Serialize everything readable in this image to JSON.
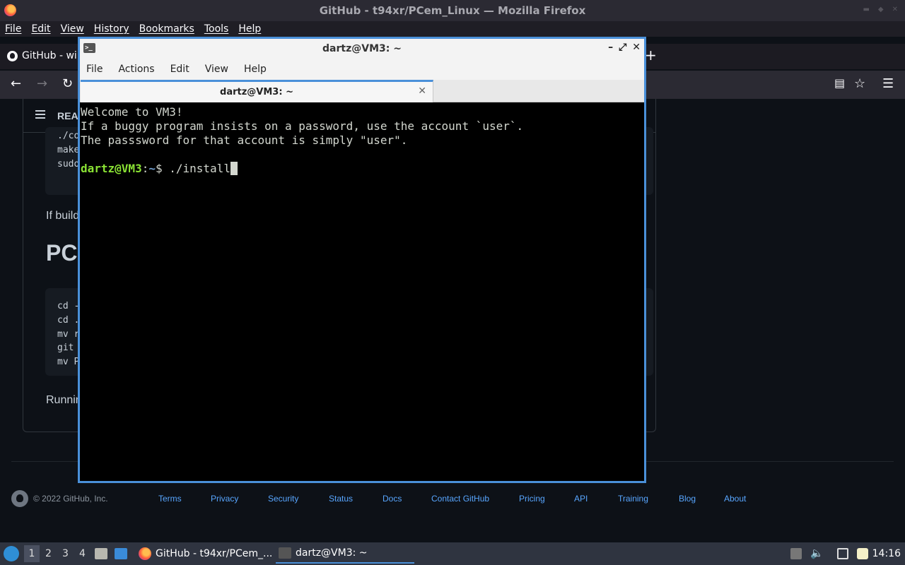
{
  "firefox": {
    "window_title": "GitHub - t94xr/PCem_Linux — Mozilla Firefox",
    "menu": [
      "File",
      "Edit",
      "View",
      "History",
      "Bookmarks",
      "Tools",
      "Help"
    ],
    "tab_label": "GitHub - wir",
    "newtab": "+"
  },
  "github": {
    "readme_title": "REA",
    "code_block_1": [
      "./co",
      "make",
      "sudo"
    ],
    "text_1": "If build",
    "heading": "PC",
    "code_block_2": [
      "cd -",
      "cd .",
      "mv r",
      "git",
      "mv P"
    ],
    "text_2": "Runnin",
    "footer": {
      "copyright": "© 2022 GitHub, Inc.",
      "links": [
        "Terms",
        "Privacy",
        "Security",
        "Status",
        "Docs",
        "Contact GitHub",
        "Pricing",
        "API",
        "Training",
        "Blog",
        "About"
      ]
    }
  },
  "terminal": {
    "title": "dartz@VM3: ~",
    "menu": [
      "File",
      "Actions",
      "Edit",
      "View",
      "Help"
    ],
    "tab_label": "dartz@VM3: ~",
    "lines": [
      "Welcome to VM3!",
      "If a buggy program insists on a password, use the account `user`.",
      "The passsword for that account is simply \"user\"."
    ],
    "prompt_user": "dartz@VM3",
    "prompt_sep": ":",
    "prompt_path": "~",
    "prompt_symbol": "$ ",
    "command": "./install"
  },
  "taskbar": {
    "workspaces": [
      "1",
      "2",
      "3",
      "4"
    ],
    "tasks": [
      "GitHub - t94xr/PCem_...",
      "dartz@VM3: ~"
    ],
    "clock": "14:16"
  },
  "colors": {
    "accent": "#4a90d9",
    "prompt_user": "#8ae234",
    "prompt_path": "#729fcf",
    "github_link": "#58a6ff"
  }
}
